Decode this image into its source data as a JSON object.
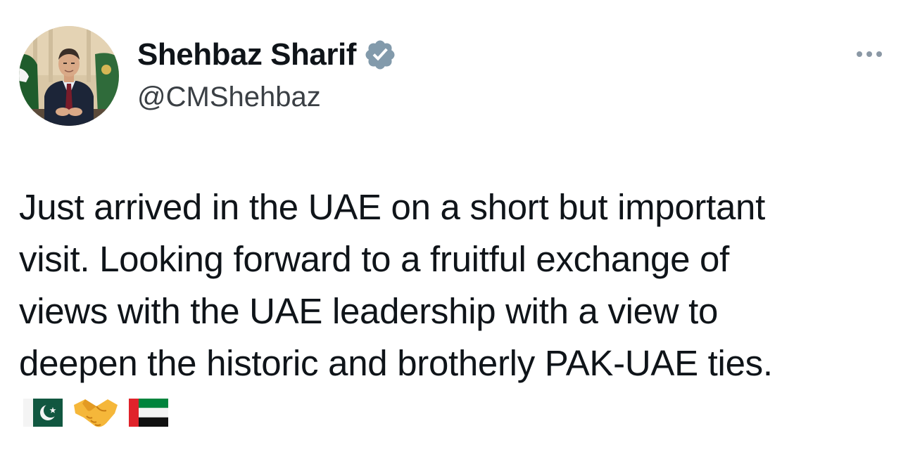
{
  "author": {
    "name": "Shehbaz Sharif",
    "handle": "@CMShehbaz",
    "verified": true,
    "avatar_icon": "profile-photo"
  },
  "tweet": {
    "text_lines": [
      "Just arrived in the UAE on a short but important",
      "visit. Looking forward to a fruitful exchange of",
      "views with the UAE leadership with a view to",
      "deepen the historic and brotherly PAK-UAE ties."
    ],
    "emojis": [
      "pakistan-flag-emoji",
      "handshake-emoji",
      "uae-flag-emoji"
    ]
  },
  "menu": {
    "icon": "more-horizontal-icon"
  },
  "colors": {
    "text": "#0f1419",
    "handle": "#3a3f44",
    "verified_badge": "#829aab",
    "more_dots": "#8b98a5"
  }
}
